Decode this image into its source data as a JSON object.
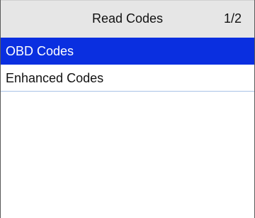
{
  "header": {
    "title": "Read Codes",
    "page_indicator": "1/2"
  },
  "menu": {
    "items": [
      {
        "label": "OBD Codes",
        "selected": true
      },
      {
        "label": "Enhanced Codes",
        "selected": false
      }
    ]
  },
  "colors": {
    "header_background": "#e6e6e6",
    "selection_highlight": "#0a2fe0",
    "divider": "#a9c3e6"
  }
}
